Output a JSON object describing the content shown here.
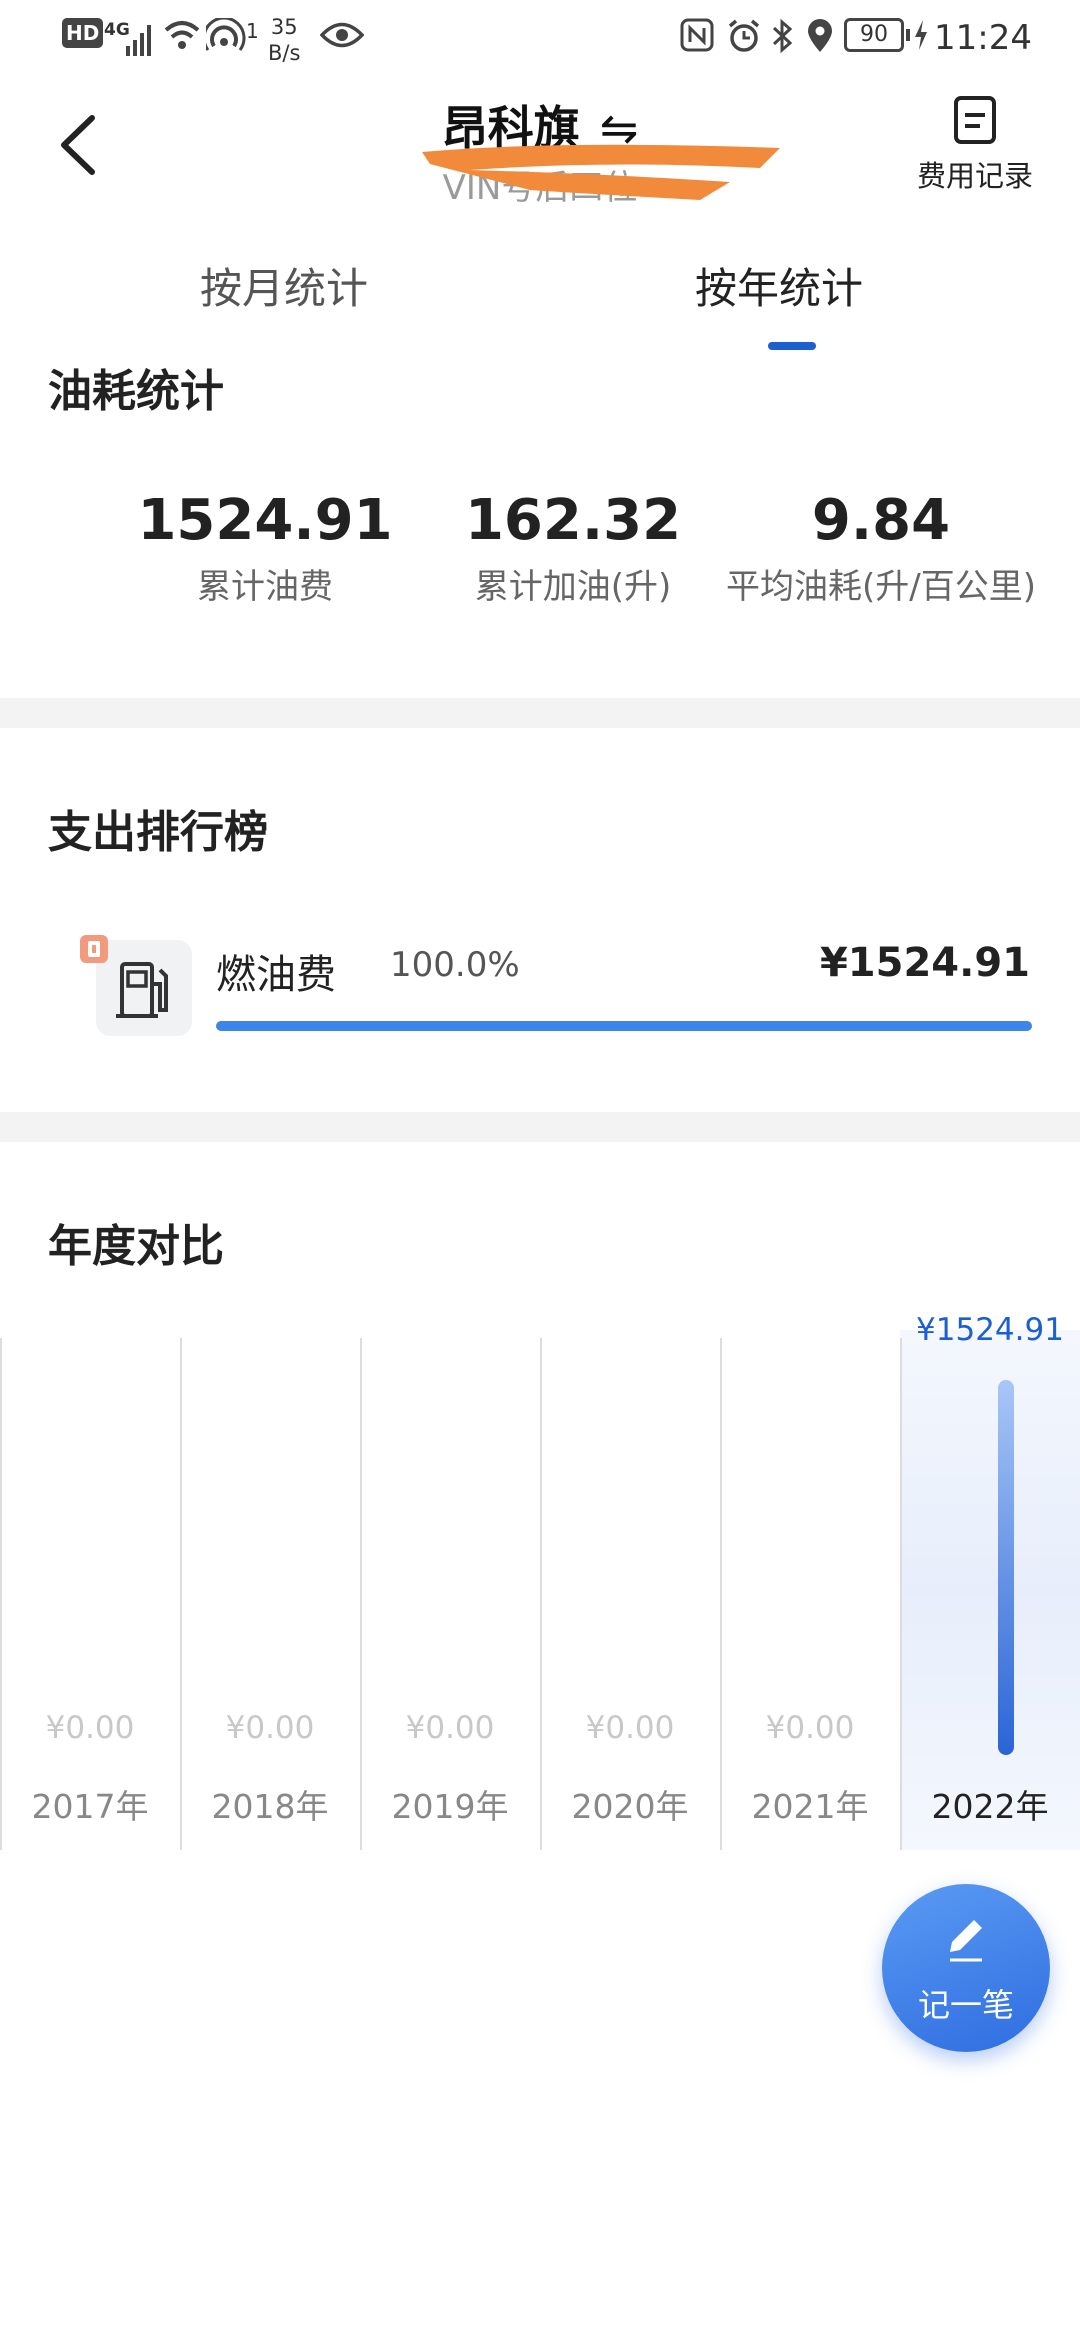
{
  "status_bar": {
    "hd": "HD",
    "network": "4G",
    "hotspot_count": "1",
    "speed_value": "35",
    "speed_unit": "B/s",
    "battery": "90",
    "time": "11:24"
  },
  "header": {
    "title": "昂科旗",
    "swap_glyph": "⇋",
    "subtitle": "VIN号后四位",
    "record_label": "费用记录"
  },
  "tabs": [
    {
      "label": "按月统计",
      "active": false
    },
    {
      "label": "按年统计",
      "active": true
    }
  ],
  "fuel_stats": {
    "title": "油耗统计",
    "items": [
      {
        "value": "1524.91",
        "label": "累计油费"
      },
      {
        "value": "162.32",
        "label": "累计加油(升)"
      },
      {
        "value": "9.84",
        "label": "平均油耗(升/百公里)"
      }
    ]
  },
  "ranking": {
    "title": "支出排行榜",
    "items": [
      {
        "name": "燃油费",
        "percent_text": "100.0%",
        "percent": 100,
        "amount": "¥1524.91",
        "icon": "fuel-pump-icon"
      }
    ]
  },
  "yearly": {
    "title": "年度对比",
    "chart_data": {
      "type": "bar",
      "categories": [
        "2017年",
        "2018年",
        "2019年",
        "2020年",
        "2021年",
        "2022年"
      ],
      "values": [
        0,
        0,
        0,
        0,
        0,
        1524.91
      ],
      "value_labels": [
        "¥0.00",
        "¥0.00",
        "¥0.00",
        "¥0.00",
        "¥0.00",
        "¥1524.91"
      ],
      "selected_index": 5,
      "colors": {
        "bar_top": "#a9c6f7",
        "bar_bottom": "#2a64d6",
        "selected_label": "#1b5fd1",
        "zero_label": "#c8c8c8"
      }
    }
  },
  "fab": {
    "label": "记一笔",
    "icon": "pen-icon"
  },
  "colors": {
    "accent": "#1b5fd1",
    "progress": "#3d85ea",
    "fab": "#3a7ae6"
  }
}
